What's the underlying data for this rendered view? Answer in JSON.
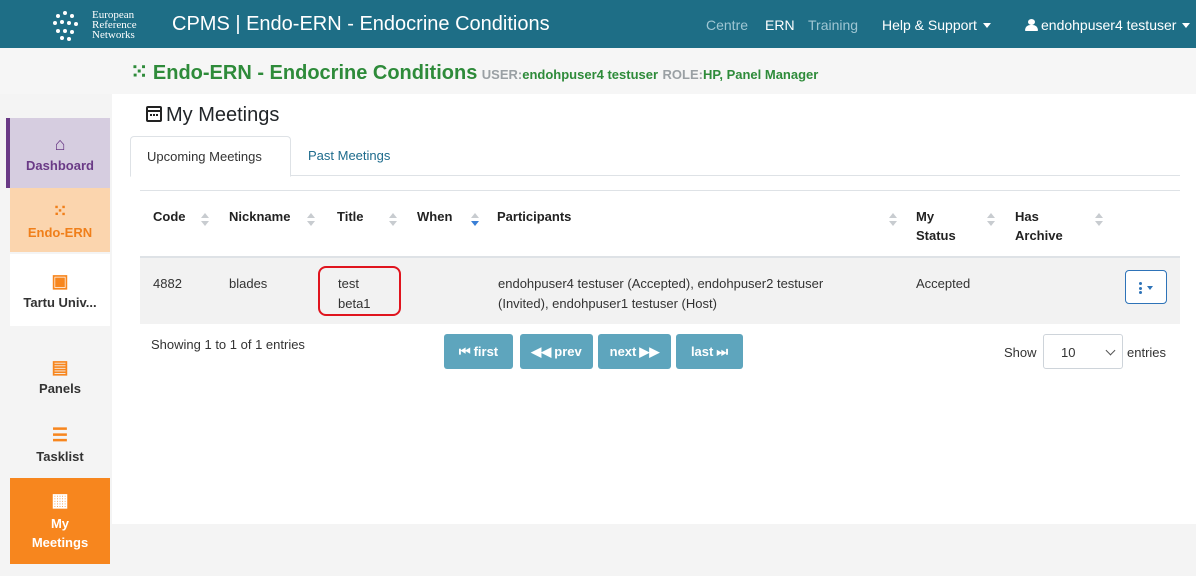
{
  "logo": {
    "line1": "European",
    "line2": "Reference",
    "line3": "Networks"
  },
  "brand": "CPMS | Endo-ERN - Endocrine Conditions",
  "topnav": {
    "centre": "Centre",
    "ern": "ERN",
    "training": "Training",
    "help": "Help & Support",
    "user": "endohpuser4 testuser"
  },
  "network": {
    "name": "Endo-ERN - Endocrine Conditions",
    "user_label": "USER:",
    "user_value": "endohpuser4 testuser",
    "role_label": "ROLE:",
    "role_value": "HP, Panel Manager"
  },
  "sidebar": {
    "items": [
      {
        "label": "Dashboard",
        "icon": "home-icon"
      },
      {
        "label": "Endo-ERN",
        "icon": "network-icon"
      },
      {
        "label": "Tartu Univ...",
        "icon": "hospital-icon"
      },
      {
        "label": "Panels",
        "icon": "clipboard-icon"
      },
      {
        "label": "Tasklist",
        "icon": "tasklist-icon"
      },
      {
        "label": "My Meetings",
        "icon": "calendar-icon"
      }
    ]
  },
  "page": {
    "title": "My Meetings"
  },
  "tabs": [
    {
      "label": "Upcoming Meetings",
      "active": true
    },
    {
      "label": "Past Meetings",
      "active": false
    }
  ],
  "table": {
    "columns": [
      "Code",
      "Nickname",
      "Title",
      "When",
      "Participants",
      "My Status",
      "Has Archive"
    ],
    "column_lines": {
      "my_status": [
        "My",
        "Status"
      ],
      "has_archive": [
        "Has",
        "Archive"
      ]
    },
    "rows": [
      {
        "code": "4882",
        "nickname": "blades",
        "title_lines": [
          "test",
          "beta1"
        ],
        "when": "",
        "participants_lines": [
          "endohpuser4 testuser (Accepted), endohpuser2 testuser",
          "(Invited), endohpuser1 testuser (Host)"
        ],
        "my_status": "Accepted",
        "has_archive": ""
      }
    ]
  },
  "pagination": {
    "info": "Showing 1 to 1 of 1 entries",
    "first": "first",
    "prev": "prev",
    "next": "next",
    "last": "last",
    "show_label": "Show",
    "page_size": "10",
    "entries_label": "entries"
  },
  "colors": {
    "navbar": "#1e6e86",
    "accent_orange": "#f7861e",
    "network_green": "#2e8b3a",
    "dashboard_purple": "#6a3a86",
    "highlight_red": "#e0141e",
    "pager_button": "#5ea5bd"
  }
}
